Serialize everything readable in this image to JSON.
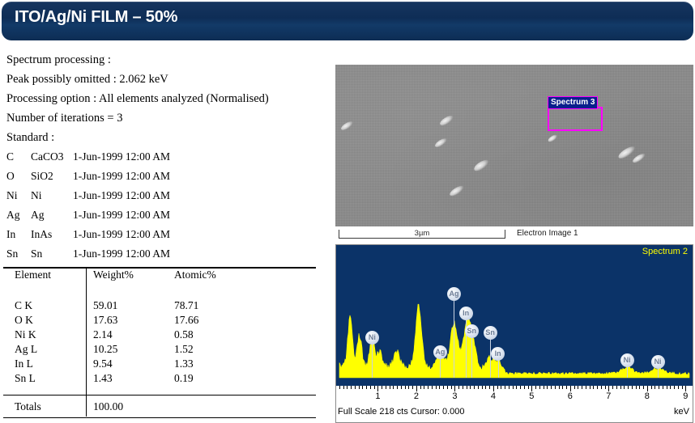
{
  "header": {
    "title": "ITO/Ag/Ni FILM – 50%",
    "bar_color": "#0e2d56"
  },
  "processing": {
    "lines": [
      "Spectrum processing :",
      "Peak possibly omitted : 2.062  keV",
      "Processing option : All  elements analyzed (Normalised)",
      "Number of iterations  = 3",
      "Standard :"
    ]
  },
  "standards": [
    {
      "symbol": "C",
      "material": "CaCO3",
      "date": "1-Jun-1999 12:00  AM"
    },
    {
      "symbol": "O",
      "material": "SiO2",
      "date": "1-Jun-1999 12:00  AM"
    },
    {
      "symbol": "Ni",
      "material": "Ni",
      "date": "1-Jun-1999 12:00  AM"
    },
    {
      "symbol": "Ag",
      "material": "Ag",
      "date": "1-Jun-1999 12:00  AM"
    },
    {
      "symbol": "In",
      "material": "InAs",
      "date": "1-Jun-1999 12:00  AM"
    },
    {
      "symbol": "Sn",
      "material": "Sn",
      "date": "1-Jun-1999 12:00  AM"
    }
  ],
  "results_table": {
    "columns": [
      "Element",
      "Weight%",
      "Atomic%"
    ],
    "rows": [
      {
        "element": "C K",
        "weight": "59.01",
        "atomic": "78.71"
      },
      {
        "element": "O K",
        "weight": "17.63",
        "atomic": "17.66"
      },
      {
        "element": "Ni K",
        "weight": "2.14",
        "atomic": "0.58"
      },
      {
        "element": "Ag L",
        "weight": "10.25",
        "atomic": "1.52"
      },
      {
        "element": "In L",
        "weight": "9.54",
        "atomic": "1.33"
      },
      {
        "element": "Sn L",
        "weight": "1.43",
        "atomic": "0.19"
      }
    ],
    "totals_label": "Totals",
    "totals_weight": "100.00"
  },
  "sem_image": {
    "marker_label": "Spectrum 3",
    "marker_border_color": "#ff00ff",
    "marker_label_bg": "#0a1f8c",
    "scalebar_label": "3µm",
    "caption": "Electron Image 1",
    "background_color": "#8b8b8b"
  },
  "eds": {
    "legend": "Spectrum 2",
    "legend_color": "#ffff00",
    "status": "Full Scale 218 cts Cursor: 0.000",
    "unit": "keV",
    "background_color": "#0b3368",
    "trace_color": "#ffff00"
  },
  "chart_data": {
    "type": "line",
    "title": "Spectrum 2",
    "xlabel": "keV",
    "ylabel": "counts",
    "xlim": [
      0.0,
      9.1
    ],
    "ylim": [
      0,
      218
    ],
    "full_scale_cts": 218,
    "cursor": 0.0,
    "grid": false,
    "legend_position": "top-right",
    "tick_labels": [
      "1",
      "2",
      "3",
      "4",
      "5",
      "6",
      "7",
      "8",
      "9"
    ],
    "annotations": [
      {
        "label": "Ni",
        "energy": 0.85,
        "height": 58
      },
      {
        "label": "Ag",
        "energy": 2.62,
        "height": 40
      },
      {
        "label": "Ag",
        "energy": 2.98,
        "height": 112
      },
      {
        "label": "In",
        "energy": 3.29,
        "height": 88
      },
      {
        "label": "Sn",
        "energy": 3.44,
        "height": 66
      },
      {
        "label": "Sn",
        "energy": 3.92,
        "height": 64
      },
      {
        "label": "In",
        "energy": 4.12,
        "height": 38
      },
      {
        "label": "Ni",
        "energy": 7.48,
        "height": 30
      },
      {
        "label": "Ni",
        "energy": 8.28,
        "height": 28
      }
    ],
    "peaks": [
      {
        "energy": 0.28,
        "counts": 86
      },
      {
        "energy": 0.52,
        "counts": 52
      },
      {
        "energy": 0.85,
        "counts": 46
      },
      {
        "energy": 1.05,
        "counts": 24
      },
      {
        "energy": 1.49,
        "counts": 26
      },
      {
        "energy": 2.06,
        "counts": 104
      },
      {
        "energy": 2.62,
        "counts": 26
      },
      {
        "energy": 2.98,
        "counts": 76
      },
      {
        "energy": 3.29,
        "counts": 58
      },
      {
        "energy": 3.44,
        "counts": 52
      },
      {
        "energy": 3.92,
        "counts": 16
      },
      {
        "energy": 4.12,
        "counts": 12
      },
      {
        "energy": 7.48,
        "counts": 10
      },
      {
        "energy": 8.28,
        "counts": 9
      }
    ],
    "baseline_counts": 8
  }
}
